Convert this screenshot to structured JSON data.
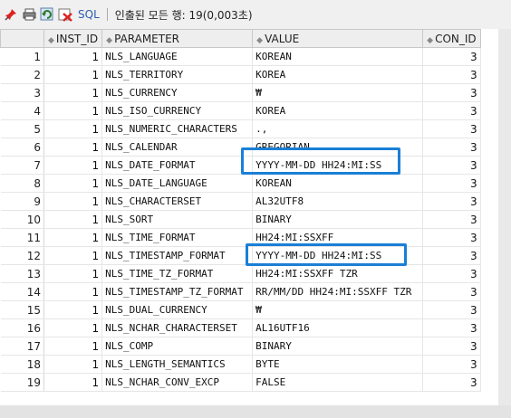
{
  "toolbar": {
    "sql_label": "SQL",
    "status": "인출된 모든 행: 19(0,003초)"
  },
  "columns": [
    "INST_ID",
    "PARAMETER",
    "VALUE",
    "CON_ID"
  ],
  "rows": [
    {
      "n": "1",
      "inst": "1",
      "param": "NLS_LANGUAGE",
      "value": "KOREAN",
      "con": "3"
    },
    {
      "n": "2",
      "inst": "1",
      "param": "NLS_TERRITORY",
      "value": "KOREA",
      "con": "3"
    },
    {
      "n": "3",
      "inst": "1",
      "param": "NLS_CURRENCY",
      "value": "₩",
      "con": "3"
    },
    {
      "n": "4",
      "inst": "1",
      "param": "NLS_ISO_CURRENCY",
      "value": "KOREA",
      "con": "3"
    },
    {
      "n": "5",
      "inst": "1",
      "param": "NLS_NUMERIC_CHARACTERS",
      "value": ".,",
      "con": "3"
    },
    {
      "n": "6",
      "inst": "1",
      "param": "NLS_CALENDAR",
      "value": "GREGORIAN",
      "con": "3"
    },
    {
      "n": "7",
      "inst": "1",
      "param": "NLS_DATE_FORMAT",
      "value": "YYYY-MM-DD HH24:MI:SS",
      "con": "3"
    },
    {
      "n": "8",
      "inst": "1",
      "param": "NLS_DATE_LANGUAGE",
      "value": "KOREAN",
      "con": "3"
    },
    {
      "n": "9",
      "inst": "1",
      "param": "NLS_CHARACTERSET",
      "value": "AL32UTF8",
      "con": "3"
    },
    {
      "n": "10",
      "inst": "1",
      "param": "NLS_SORT",
      "value": "BINARY",
      "con": "3"
    },
    {
      "n": "11",
      "inst": "1",
      "param": "NLS_TIME_FORMAT",
      "value": "HH24:MI:SSXFF",
      "con": "3"
    },
    {
      "n": "12",
      "inst": "1",
      "param": "NLS_TIMESTAMP_FORMAT",
      "value": "YYYY-MM-DD HH24:MI:SS",
      "con": "3"
    },
    {
      "n": "13",
      "inst": "1",
      "param": "NLS_TIME_TZ_FORMAT",
      "value": "HH24:MI:SSXFF TZR",
      "con": "3"
    },
    {
      "n": "14",
      "inst": "1",
      "param": "NLS_TIMESTAMP_TZ_FORMAT",
      "value": "RR/MM/DD HH24:MI:SSXFF TZR",
      "con": "3"
    },
    {
      "n": "15",
      "inst": "1",
      "param": "NLS_DUAL_CURRENCY",
      "value": "₩",
      "con": "3"
    },
    {
      "n": "16",
      "inst": "1",
      "param": "NLS_NCHAR_CHARACTERSET",
      "value": "AL16UTF16",
      "con": "3"
    },
    {
      "n": "17",
      "inst": "1",
      "param": "NLS_COMP",
      "value": "BINARY",
      "con": "3"
    },
    {
      "n": "18",
      "inst": "1",
      "param": "NLS_LENGTH_SEMANTICS",
      "value": "BYTE",
      "con": "3"
    },
    {
      "n": "19",
      "inst": "1",
      "param": "NLS_NCHAR_CONV_EXCP",
      "value": "FALSE",
      "con": "3"
    }
  ],
  "highlight_color": "#1a7fd6",
  "icons": [
    "pin-icon",
    "print-icon",
    "refresh-icon",
    "clear-icon"
  ]
}
